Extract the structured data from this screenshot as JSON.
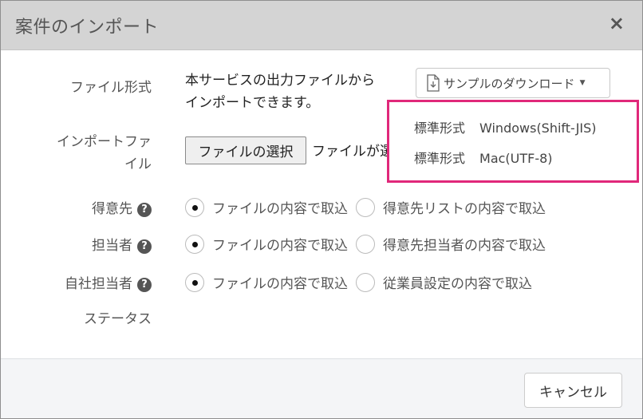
{
  "dialog": {
    "title": "案件のインポート",
    "close_icon": "×"
  },
  "form": {
    "file_format_label": "ファイル形式",
    "file_format_desc_line1": "本サービスの出力ファイルから",
    "file_format_desc_line2": "インポートできます。",
    "download_button_label": "サンプルのダウンロード",
    "import_file_label_line1": "インポートファ",
    "import_file_label_line2": "イル",
    "choose_file_label": "ファイルの選択",
    "file_status": "ファイルが選択されていません",
    "client_label": "得意先",
    "person_label": "担当者",
    "own_person_label": "自社担当者",
    "status_label": "ステータス",
    "help_icon": "?"
  },
  "radios": {
    "client": {
      "opt1": "ファイルの内容で取込",
      "opt2": "得意先リストの内容で取込",
      "selected": 1
    },
    "person": {
      "opt1": "ファイルの内容で取込",
      "opt2": "得意先担当者の内容で取込",
      "selected": 1
    },
    "own_person": {
      "opt1": "ファイルの内容で取込",
      "opt2": "従業員設定の内容で取込",
      "selected": 1
    }
  },
  "dropdown": {
    "items": [
      {
        "type": "標準形式",
        "format": "Windows(Shift-JIS)"
      },
      {
        "type": "標準形式",
        "format": "Mac(UTF-8)"
      }
    ]
  },
  "footer": {
    "cancel_label": "キャンセル"
  },
  "colors": {
    "highlight": "#e0287a",
    "header_bg": "#d4d4d4"
  }
}
